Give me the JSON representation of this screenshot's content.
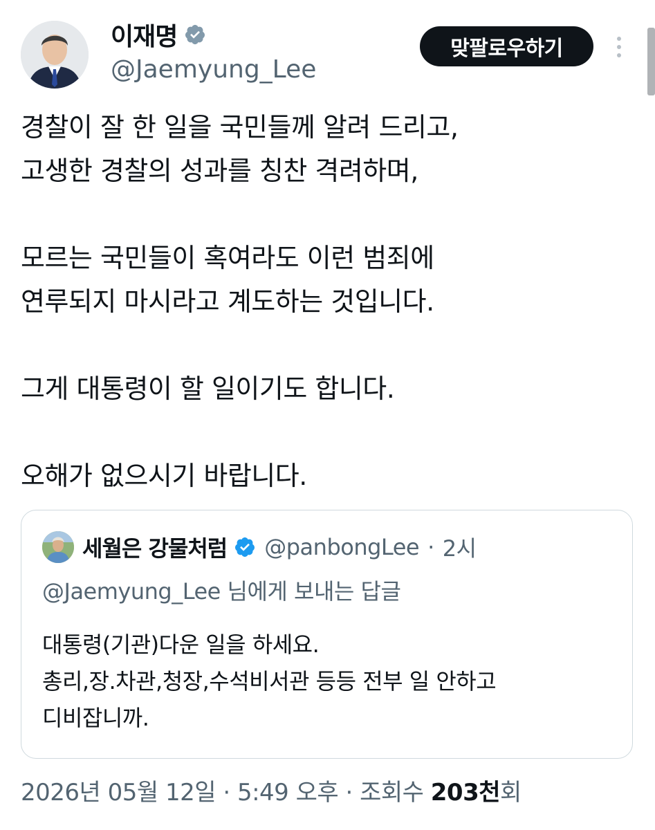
{
  "author": {
    "name": "이재명",
    "handle": "@Jaemyung_Lee",
    "verified_color": "#829aab",
    "follow_button": "맞팔로우하기",
    "avatar_icon": "profile-photo"
  },
  "tweet": {
    "lines": [
      "경찰이 잘 한 일을 국민들께 알려 드리고,",
      "고생한 경찰의 성과를 칭찬 격려하며,",
      "",
      "모르는 국민들이 혹여라도 이런 범죄에",
      "연루되지 마시라고 계도하는 것입니다.",
      "",
      "그게 대통령이 할 일이기도 합니다.",
      "",
      "오해가 없으시기 바랍니다."
    ]
  },
  "quote": {
    "name": "세월은 강물처럼",
    "verified_color": "#1d9bf0",
    "handle": "@panbongLee",
    "separator": "·",
    "time": "2시",
    "reply_to": "@Jaemyung_Lee 님에게 보내는 답글",
    "lines": [
      "대통령(기관)다운 일을 하세요.",
      "총리,장.차관,청장,수석비서관 등등 전부 일 안하고",
      "디비잡니까."
    ]
  },
  "meta": {
    "date": "2026년 05월 12일",
    "sep1": " · ",
    "time": "5:49 오후",
    "sep2": " · ",
    "views_label": "조회수 ",
    "views_value": "203천",
    "views_suffix": "회"
  }
}
